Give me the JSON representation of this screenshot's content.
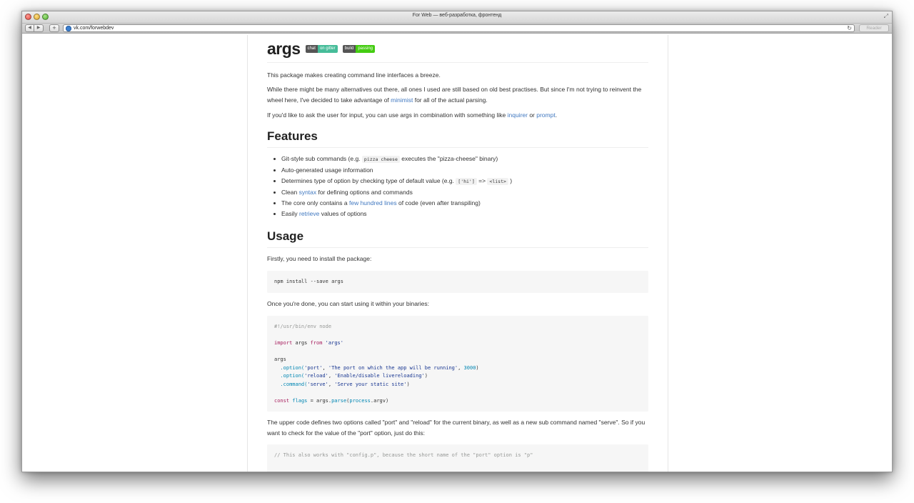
{
  "window": {
    "title": "For Web — веб-разработка, фронтенд",
    "url": "vk.com/forwebdev",
    "reader_label": "Reader"
  },
  "article": {
    "title": "args",
    "badges": [
      {
        "left": "chat",
        "right": "on gitter",
        "color": "#46bc99"
      },
      {
        "left": "build",
        "right": "passing",
        "color": "#44cc11"
      }
    ],
    "intro": "This package makes creating command line interfaces a breeze.",
    "para2_a": "While there might be many alternatives out there, all ones I used are still based on old best practises. But since I'm not trying to reinvent the wheel here, I've decided to take advantage of ",
    "para2_link": "minimist",
    "para2_b": " for all of the actual parsing.",
    "para3_a": "If you'd like to ask the user for input, you can use args in combination with something like ",
    "para3_link1": "inquirer",
    "para3_mid": " or ",
    "para3_link2": "prompt",
    "para3_end": ".",
    "features_heading": "Features",
    "features": {
      "f1_a": "Git-style sub commands (e.g. ",
      "f1_code": "pizza cheese",
      "f1_b": " executes the \"pizza-cheese\" binary)",
      "f2": "Auto-generated usage information",
      "f3_a": "Determines type of option by checking type of default value (e.g. ",
      "f3_code1": "['hi']",
      "f3_mid": " => ",
      "f3_code2": "<list>",
      "f3_b": " )",
      "f4_a": "Clean ",
      "f4_link": "syntax",
      "f4_b": " for defining options and commands",
      "f5_a": "The core only contains a ",
      "f5_link": "few hundred lines",
      "f5_b": " of code (even after transpiling)",
      "f6_a": "Easily ",
      "f6_link": "retrieve",
      "f6_b": " values of options"
    },
    "usage_heading": "Usage",
    "usage_p1": "Firstly, you need to install the package:",
    "install_cmd": "npm install --save args",
    "usage_p2": "Once you're done, you can start using it within your binaries:",
    "code": {
      "shebang": "#!/usr/bin/env node",
      "import_kw": "import",
      "import_mid": " args ",
      "from_kw": "from",
      "import_str": "'args'",
      "args": "args",
      "opt1_fn": "  .option(",
      "opt1_s1": "'port'",
      "opt1_s2": "'The port on which the app will be running'",
      "opt1_num": "3000",
      "opt2_fn": "  .option(",
      "opt2_s1": "'reload'",
      "opt2_s2": "'Enable/disable livereloading'",
      "cmd_fn": "  .command(",
      "cmd_s1": "'serve'",
      "cmd_s2": "'Serve your static site'",
      "const_kw": "const",
      "flags_var": "flags",
      "eq": " = args.",
      "parse_fn": "parse",
      "process": "process",
      "argv": ".argv)"
    },
    "usage_p3": "The upper code defines two options called \"port\" and \"reload\" for the current binary, as well as a new sub command named \"serve\". So if you want to check for the value of the \"port\" option, just do this:",
    "code2_comment": "// This also works with \"config.p\", because the short name of the \"port\" option is \"p\""
  }
}
